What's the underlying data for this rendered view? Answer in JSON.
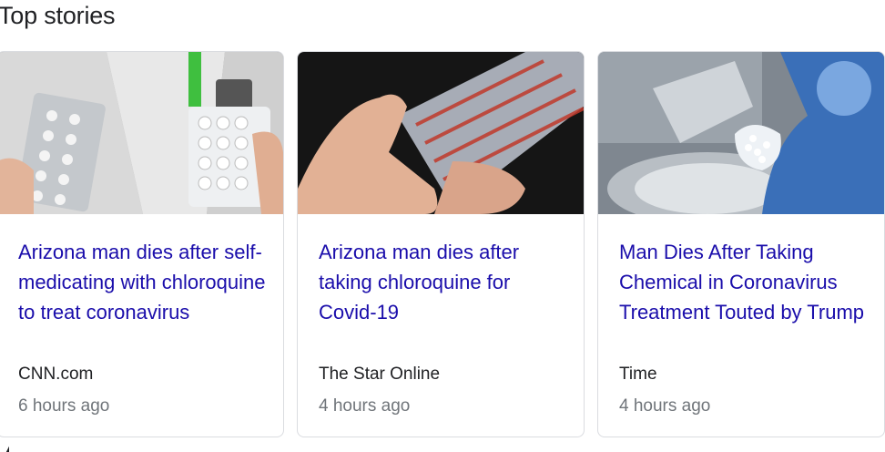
{
  "section": {
    "title": "Top stories"
  },
  "stories": [
    {
      "headline": "Arizona man dies after self-medicating with chloroquine to treat coronavirus",
      "source": "CNN.com",
      "time": "6 hours ago",
      "image": "pill-blister-packs-photo"
    },
    {
      "headline": "Arizona man dies after taking chloroquine for Covid-19",
      "source": "The Star Online",
      "time": "4 hours ago",
      "image": "hand-holding-blister-pack-photo"
    },
    {
      "headline": "Man Dies After Taking Chemical in Coronavirus Treatment Touted by Trump",
      "source": "Time",
      "time": "4 hours ago",
      "image": "lab-worker-with-pills-photo"
    }
  ],
  "colors": {
    "headline": "#1a0dab",
    "source": "#202124",
    "time": "#70757a",
    "card_border": "#dadce0"
  }
}
